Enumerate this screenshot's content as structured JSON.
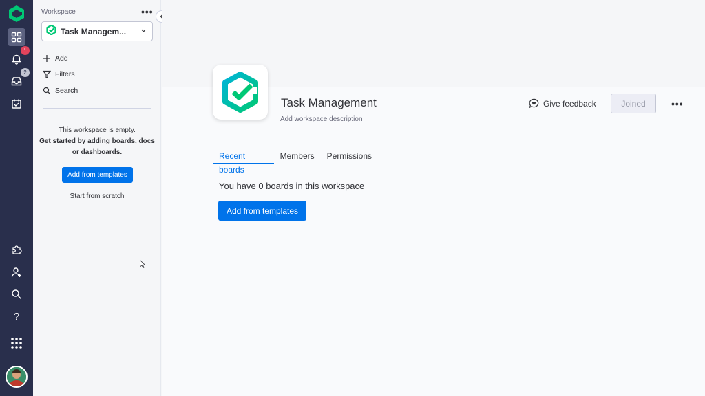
{
  "colors": {
    "rail_bg": "#292f4c",
    "accent": "#0073ea",
    "brand_green": "#00c875",
    "badge_red": "#e2445c"
  },
  "rail": {
    "top_items": [
      {
        "icon": "app-logo-icon"
      },
      {
        "icon": "workspace-grid-icon",
        "active": true
      },
      {
        "icon": "bell-icon",
        "badge": "1"
      },
      {
        "icon": "inbox-icon",
        "badge": "2"
      },
      {
        "icon": "my-work-calendar-icon"
      }
    ],
    "bottom_items": [
      {
        "icon": "puzzle-icon"
      },
      {
        "icon": "invite-user-icon"
      },
      {
        "icon": "search-icon"
      },
      {
        "icon": "help-icon",
        "glyph": "?"
      },
      {
        "icon": "apps-grid-icon"
      }
    ]
  },
  "sidebar": {
    "label": "Workspace",
    "more": "•••",
    "selected_workspace": "Task Managem...",
    "actions": [
      {
        "label": "Add",
        "icon": "plus-icon"
      },
      {
        "label": "Filters",
        "icon": "filter-icon"
      },
      {
        "label": "Search",
        "icon": "search-icon"
      }
    ],
    "empty_line1": "This workspace is empty.",
    "empty_line2": "Get started by adding boards, docs",
    "empty_line3": "or dashboards.",
    "add_templates": "Add from templates",
    "start_scratch": "Start from scratch"
  },
  "main": {
    "title": "Task Management",
    "description": "Add workspace description",
    "feedback": "Give feedback",
    "joined": "Joined",
    "more": "•••",
    "tabs": [
      {
        "label": "Recent boards",
        "active": true
      },
      {
        "label": "Members",
        "active": false
      },
      {
        "label": "Permissions",
        "active": false
      }
    ],
    "boards_count": "You have 0 boards in this workspace",
    "add_templates": "Add from templates"
  }
}
